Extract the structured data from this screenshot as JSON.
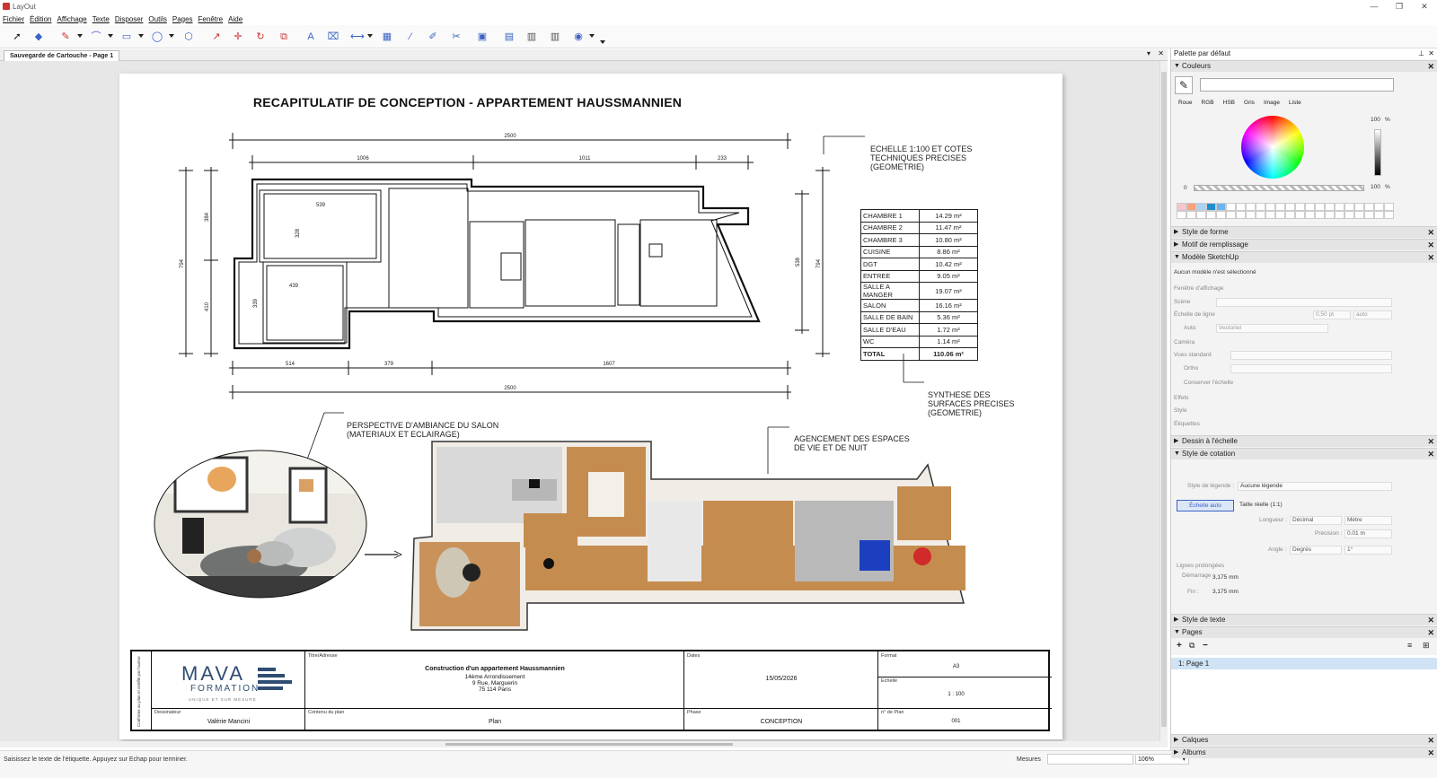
{
  "window": {
    "title": "LayOut",
    "controls": [
      "—",
      "❐",
      "✕"
    ]
  },
  "menu": [
    "Fichier",
    "Édition",
    "Affichage",
    "Texte",
    "Disposer",
    "Outils",
    "Pages",
    "Fenêtre",
    "Aide"
  ],
  "tab": {
    "label": "Sauvegarde de Cartouche - Page 1",
    "close": "✕",
    "dropdown": "▾"
  },
  "drawing": {
    "title": "RECAPITULATIF DE CONCEPTION - APPARTEMENT HAUSSMANNIEN",
    "dims": {
      "top_total": "2500",
      "top1": "1006",
      "top2": "1011",
      "top3": "233",
      "bottom1": "514",
      "bottom2": "379",
      "bottom3": "1607",
      "bottom_total": "2500",
      "left1": "384",
      "left2": "410",
      "left_total": "794",
      "right1": "538",
      "right_total": "794",
      "room1": "539",
      "room2": "439",
      "room3": "328",
      "room4": "339"
    },
    "notes": {
      "scale": "ECHELLE 1:100 ET COTES TECHNIQUES PRECISES (GEOMETRIE)",
      "synth": "SYNTHESE DES SURFACES PRECISES (GEOMETRIE)",
      "perspective": "PERSPECTIVE D'AMBIANCE DU SALON (MATERIAUX ET ECLAIRAGE)",
      "layout": "AGENCEMENT DES ESPACES DE VIE ET DE NUIT"
    },
    "areas": [
      [
        "CHAMBRE 1",
        "14.29 m²"
      ],
      [
        "CHAMBRE 2",
        "11.47 m²"
      ],
      [
        "CHAMBRE 3",
        "10.80 m²"
      ],
      [
        "CUISINE",
        "8.86 m²"
      ],
      [
        "DGT",
        "10.42 m²"
      ],
      [
        "ENTREE",
        "9.05 m²"
      ],
      [
        "SALLE A MANGER",
        "19.07 m²"
      ],
      [
        "SALON",
        "16.16 m²"
      ],
      [
        "SALLE DE BAIN",
        "5.36 m²"
      ],
      [
        "SALLE D'EAU",
        "1.72 m²"
      ],
      [
        "WC",
        "1.14 m²"
      ],
      [
        "TOTAL",
        "110.06 m²"
      ]
    ],
    "cartouche": {
      "side": "Conforme au plan et certifié par l'auteur",
      "logo_main": "MAVA",
      "logo_sub": "FORMATION",
      "logo_tag": "UNIQUE ET SUR MESURE",
      "lbl_titre": "Titre/Adresse",
      "titre": "Construction d'un appartement Haussmannien",
      "addr1": "14ème Arrondissement",
      "addr2": "9 Rue, Marguerin",
      "addr3": "75 114 Paris",
      "lbl_dates": "Dates",
      "date": "15/05/2026",
      "lbl_format": "Format",
      "format": "A3",
      "lbl_echelle": "Echelle",
      "echelle": "1 : 100",
      "lbl_dessinateur": "Dessinateur",
      "dessinateur": "Valérie Mancini",
      "lbl_contenu": "Contenu du plan",
      "contenu": "Plan",
      "lbl_phase": "Phase",
      "phase": "CONCEPTION",
      "lbl_nplan": "n° de Plan",
      "nplan": "001"
    }
  },
  "status": {
    "text": "Saisissez le texte de l'étiquette. Appuyez sur Echap pour terminer.",
    "measures": "Mesures",
    "zoom": "106%"
  },
  "panel": {
    "title": "Palette par défaut",
    "sections": {
      "colors": "Couleurs",
      "shape": "Style de forme",
      "fill": "Motif de remplissage",
      "sketchup": "Modèle SketchUp",
      "scale": "Dessin à l'échelle",
      "dim": "Style de cotation",
      "text": "Style de texte",
      "pages": "Pages",
      "layers": "Calques",
      "albums": "Albums"
    },
    "color_tabs": [
      "Roue",
      "RGB",
      "HSB",
      "Gris",
      "Image",
      "Liste"
    ],
    "color_val1": "100",
    "color_val2": "100",
    "pct": "%",
    "zero": "0",
    "sk_none": "Aucun modèle n'est sélectionné",
    "sk_rows": [
      "Fenêtre d'affichage",
      "Scène",
      "Échelle de ligne",
      "Auto",
      "Caméra",
      "Vues standard",
      "Ortho",
      "Conserver l'échelle",
      "Effets",
      "Style",
      "Étiquettes"
    ],
    "sk_line": "0,50 pt",
    "sk_auto": "auto",
    "sk_vector": "Vectoriel",
    "dim_legend_label": "Style de légende :",
    "dim_legend": "Aucune légende",
    "dim_auto": "Échelle auto",
    "dim_real": "Taille réelle (1:1)",
    "dim_length": "Longueur :",
    "dim_decimal": "Décimal",
    "dim_metre": "Mètre",
    "dim_precision": "Précision :",
    "dim_prec_val": "0.01 m",
    "dim_angle": "Angle :",
    "dim_deg": "Degrés",
    "dim_deg_val": "1°",
    "dim_ext": "Lignes prolongées",
    "dim_start": "Démarrage :",
    "dim_start_val": "3,175 mm",
    "dim_end": "Fin :",
    "dim_end_val": "3,175 mm",
    "page_item": "1: Page 1"
  }
}
